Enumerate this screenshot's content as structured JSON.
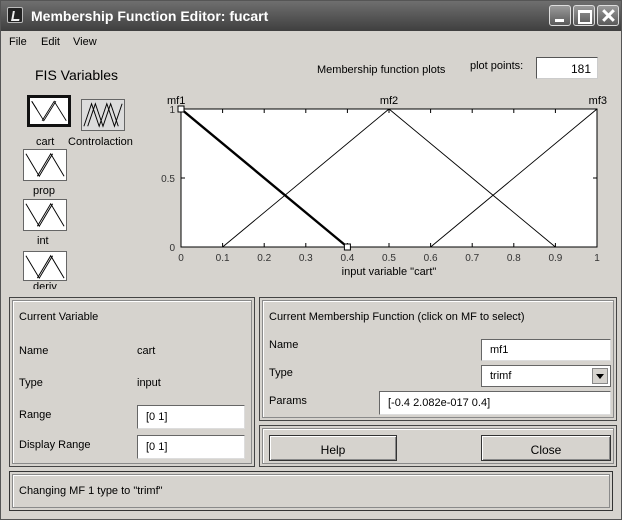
{
  "window": {
    "title": "Membership Function Editor: fucart"
  },
  "menu": [
    "File",
    "Edit",
    "View"
  ],
  "header": {
    "fis_variables_label": "FIS Variables",
    "plots_label": "Membership function plots",
    "plot_points_label": "plot points:",
    "plot_points_value": "181"
  },
  "variables": [
    {
      "name": "cart",
      "kind": "input",
      "selected": true
    },
    {
      "name": "Controlaction",
      "kind": "output",
      "selected": false
    },
    {
      "name": "prop",
      "kind": "input",
      "selected": false
    },
    {
      "name": "int",
      "kind": "input",
      "selected": false
    },
    {
      "name": "deriv",
      "kind": "input",
      "selected": false
    }
  ],
  "chart_data": {
    "type": "line",
    "xlabel": "input variable \"cart\"",
    "xlim": [
      0,
      1
    ],
    "ylim": [
      0,
      1
    ],
    "x_ticks": [
      "0",
      "0.1",
      "0.2",
      "0.3",
      "0.4",
      "0.5",
      "0.6",
      "0.7",
      "0.8",
      "0.9",
      "1"
    ],
    "y_ticks": [
      "0",
      "0.5",
      "1"
    ],
    "series": [
      {
        "name": "mf1",
        "x": [
          -0.4,
          0,
          0.4
        ],
        "y": [
          0,
          1,
          0
        ],
        "selected": true
      },
      {
        "name": "mf2",
        "x": [
          0.1,
          0.5,
          0.9
        ],
        "y": [
          0,
          1,
          0
        ],
        "selected": false
      },
      {
        "name": "mf3",
        "x": [
          0.6,
          1.0,
          1.4
        ],
        "y": [
          0,
          1,
          0
        ],
        "selected": false
      }
    ]
  },
  "current_variable": {
    "title": "Current Variable",
    "name_label": "Name",
    "name_value": "cart",
    "type_label": "Type",
    "type_value": "input",
    "range_label": "Range",
    "range_value": "[0 1]",
    "display_range_label": "Display Range",
    "display_range_value": "[0 1]"
  },
  "current_mf": {
    "title": "Current Membership Function (click on MF to select)",
    "name_label": "Name",
    "name_value": "mf1",
    "type_label": "Type",
    "type_value": "trimf",
    "params_label": "Params",
    "params_value": "[-0.4 2.082e-017 0.4]"
  },
  "buttons": {
    "help": "Help",
    "close": "Close"
  },
  "status": "Changing MF 1 type to \"trimf\""
}
